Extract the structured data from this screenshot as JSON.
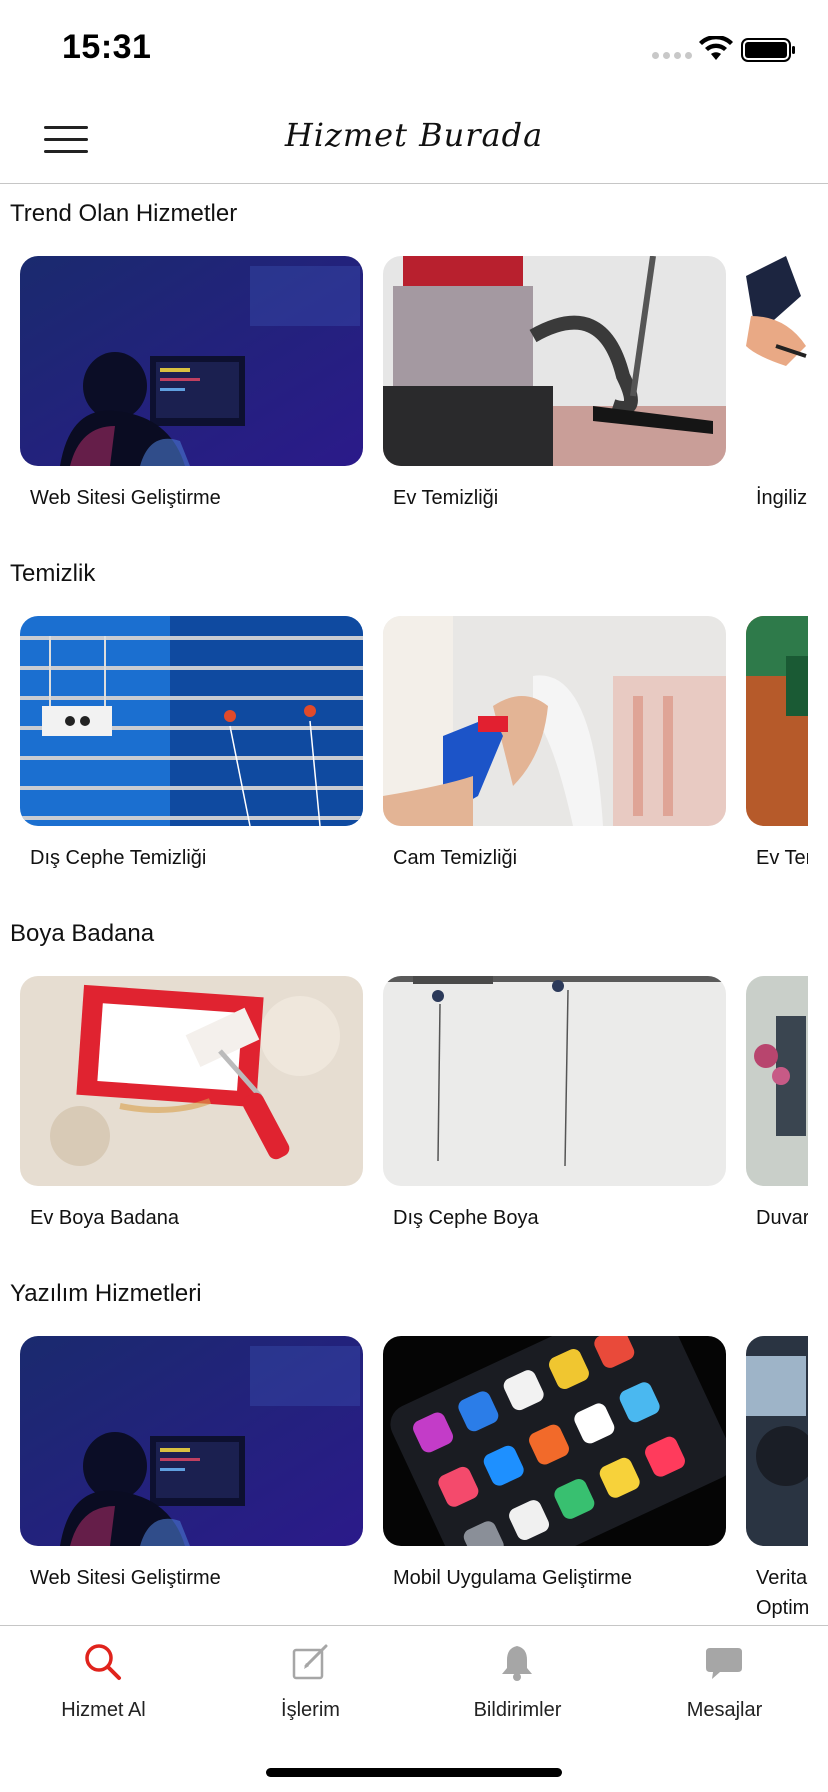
{
  "status_bar": {
    "time": "15:31"
  },
  "header": {
    "title": "Hizmet Burada"
  },
  "sections": [
    {
      "title": "Trend Olan Hizmetler",
      "cards": [
        {
          "label": "Web Sitesi Geliştirme"
        },
        {
          "label": "Ev Temizliği"
        },
        {
          "label": "İngiliz"
        }
      ]
    },
    {
      "title": "Temizlik",
      "cards": [
        {
          "label": "Dış Cephe Temizliği"
        },
        {
          "label": "Cam Temizliği"
        },
        {
          "label": "Ev Ter"
        }
      ]
    },
    {
      "title": "Boya Badana",
      "cards": [
        {
          "label": "Ev Boya Badana"
        },
        {
          "label": "Dış Cephe Boya"
        },
        {
          "label": "Duvar"
        }
      ]
    },
    {
      "title": "Yazılım Hizmetleri",
      "cards": [
        {
          "label": "Web Sitesi Geliştirme"
        },
        {
          "label": "Mobil Uygulama Geliştirme"
        },
        {
          "label": "Verital Optim"
        }
      ]
    }
  ],
  "tab_bar": {
    "tabs": [
      {
        "label": "Hizmet Al",
        "icon": "search-icon",
        "active": true
      },
      {
        "label": "İşlerim",
        "icon": "edit-icon",
        "active": false
      },
      {
        "label": "Bildirimler",
        "icon": "bell-icon",
        "active": false
      },
      {
        "label": "Mesajlar",
        "icon": "chat-icon",
        "active": false
      }
    ]
  },
  "colors": {
    "accent": "#e0231c",
    "inactive_icon": "#a6a6a6",
    "divider": "#c6c6c6"
  }
}
